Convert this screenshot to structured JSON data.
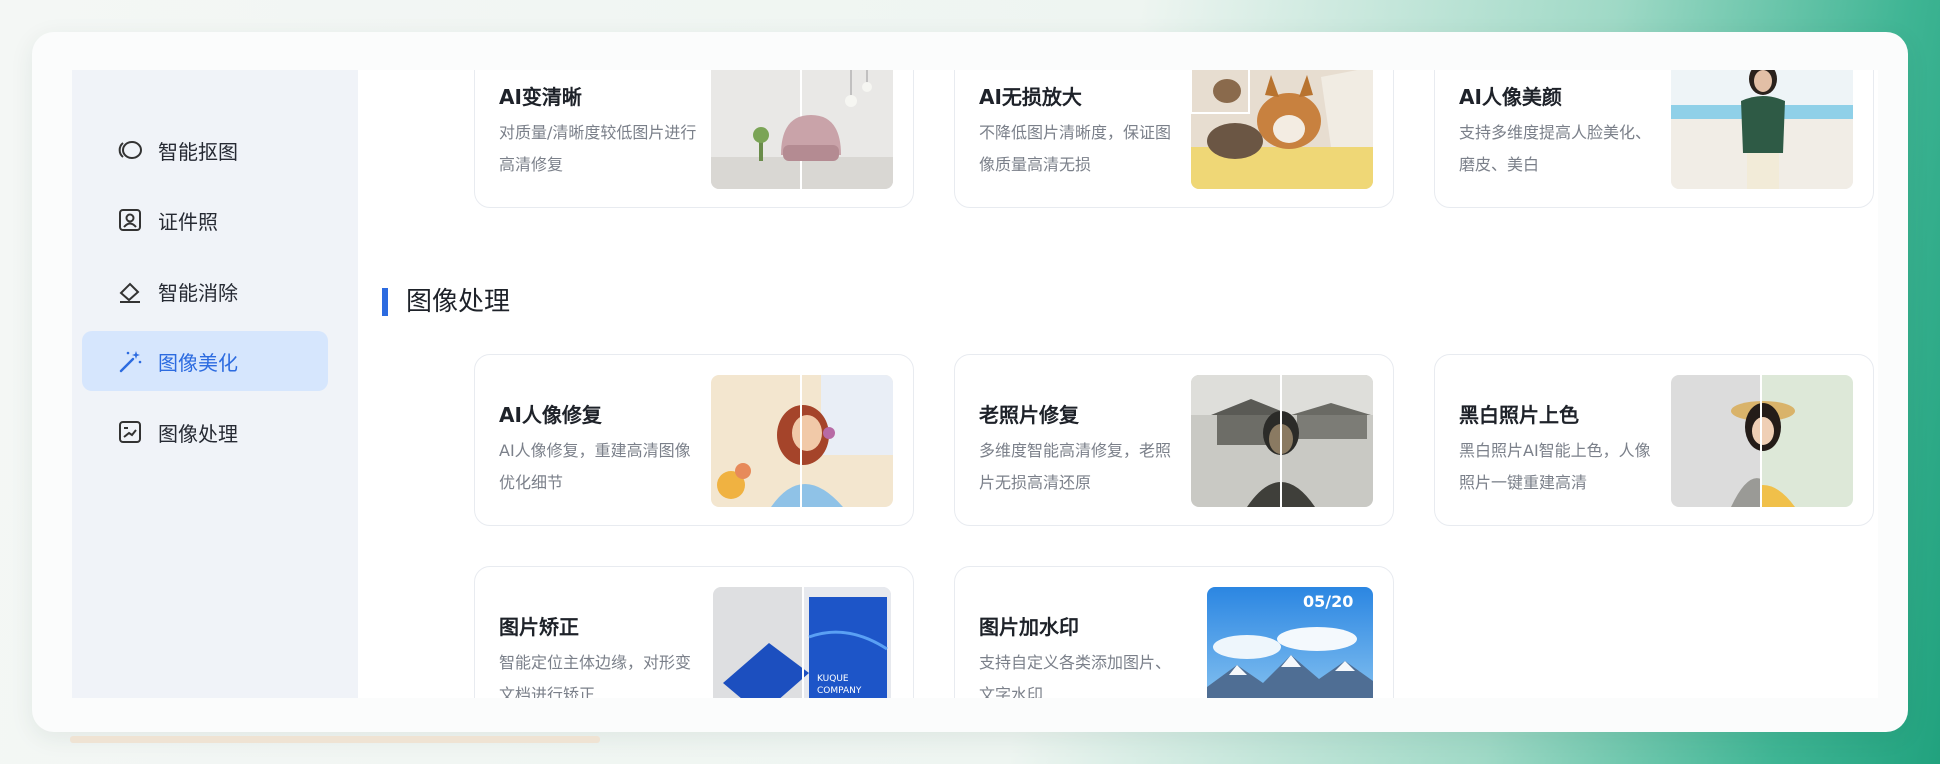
{
  "sidebar": {
    "items": [
      {
        "label": "智能抠图",
        "icon": "lasso-icon",
        "active": false
      },
      {
        "label": "证件照",
        "icon": "id-photo-icon",
        "active": false
      },
      {
        "label": "智能消除",
        "icon": "eraser-icon",
        "active": false
      },
      {
        "label": "图像美化",
        "icon": "magic-wand-icon",
        "active": true
      },
      {
        "label": "图像处理",
        "icon": "image-edit-icon",
        "active": false
      }
    ]
  },
  "top_cards": [
    {
      "title": "AI变清晰",
      "desc": "对质量/清晰度较低图片进行高清修复",
      "thumb": "interior-chair-thumbnail"
    },
    {
      "title": "AI无损放大",
      "desc": "不降低图片清晰度，保证图像质量高清无损",
      "thumb": "corgi-dogs-thumbnail"
    },
    {
      "title": "AI人像美颜",
      "desc": "支持多维度提高人脸美化、磨皮、美白",
      "thumb": "woman-portrait-thumbnail"
    }
  ],
  "section": {
    "title": "图像处理"
  },
  "cards": [
    {
      "title": "AI人像修复",
      "desc": "AI人像修复，重建高清图像优化细节",
      "thumb": "portrait-restore-thumbnail"
    },
    {
      "title": "老照片修复",
      "desc": "多维度智能高清修复，老照片无损高清还原",
      "thumb": "old-photo-thumbnail"
    },
    {
      "title": "黑白照片上色",
      "desc": "黑白照片AI智能上色，人像照片一键重建高清",
      "thumb": "colorize-thumbnail"
    },
    {
      "title": "图片矫正",
      "desc": "智能定位主体边缘，对形变文档进行矫正",
      "thumb": "document-correction-thumbnail",
      "thumb_text": "KUQUE COMPANY"
    },
    {
      "title": "图片加水印",
      "desc": "支持自定义各类添加图片、文字水印",
      "thumb": "mountain-watermark-thumbnail",
      "thumb_text": "05/20"
    }
  ],
  "colors": {
    "accent": "#2c6be0",
    "active_bg": "#d6e6fd",
    "sidebar_bg": "#f0f3f8"
  }
}
